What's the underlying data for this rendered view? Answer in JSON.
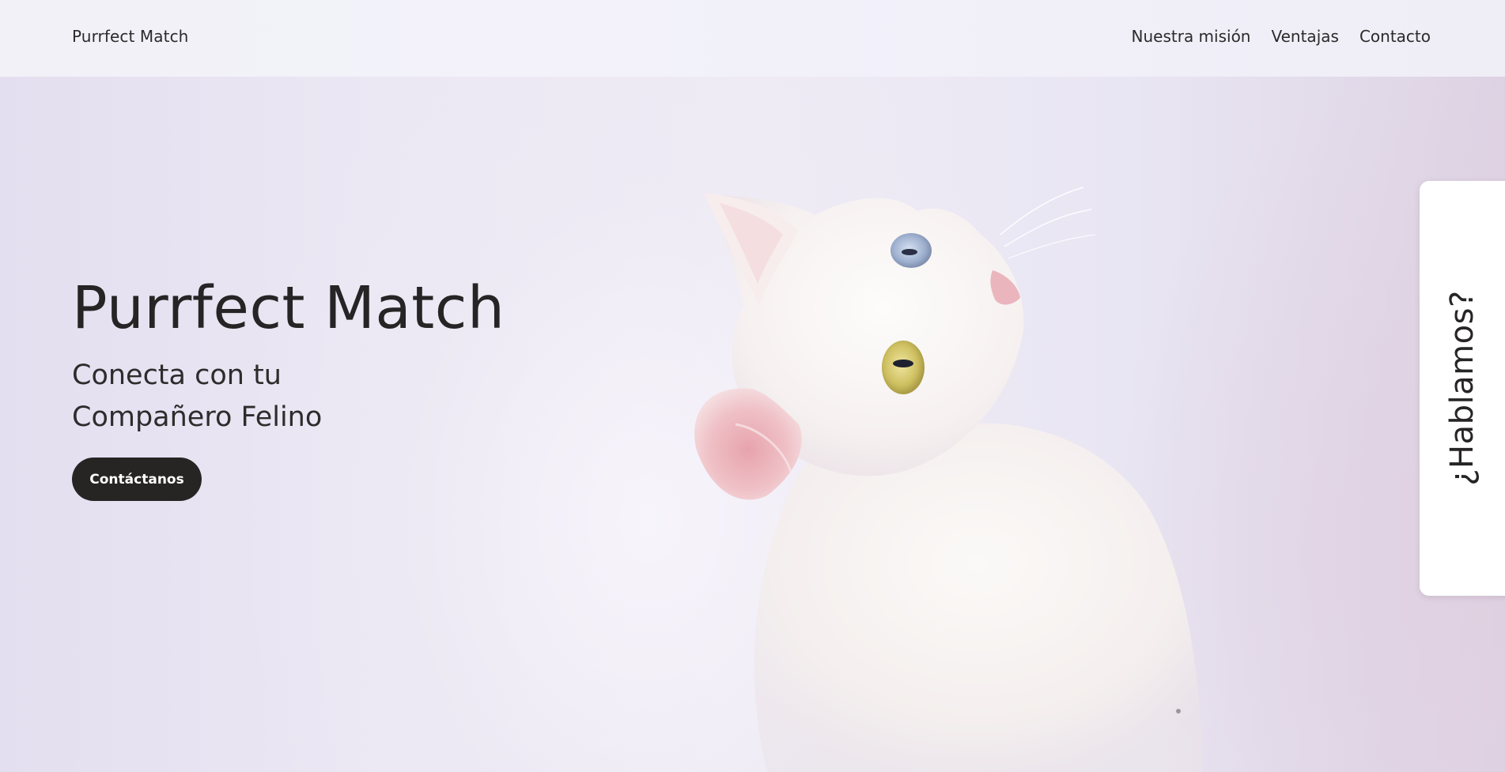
{
  "header": {
    "brand": "Purrfect Match",
    "nav": [
      {
        "label": "Nuestra misión"
      },
      {
        "label": "Ventajas"
      },
      {
        "label": "Contacto"
      }
    ]
  },
  "hero": {
    "title": "Purrfect Match",
    "subtitle_line1": "Conecta con tu",
    "subtitle_line2": "Compañero Felino",
    "cta_label": "Contáctanos",
    "image": "white-cat-photo"
  },
  "side_tab": {
    "label": "¿Hablamos?"
  },
  "colors": {
    "text": "#262424",
    "button_bg": "#272524",
    "button_text": "#ffffff",
    "background": "#ebe8f3",
    "side_tab_bg": "#ffffff"
  }
}
